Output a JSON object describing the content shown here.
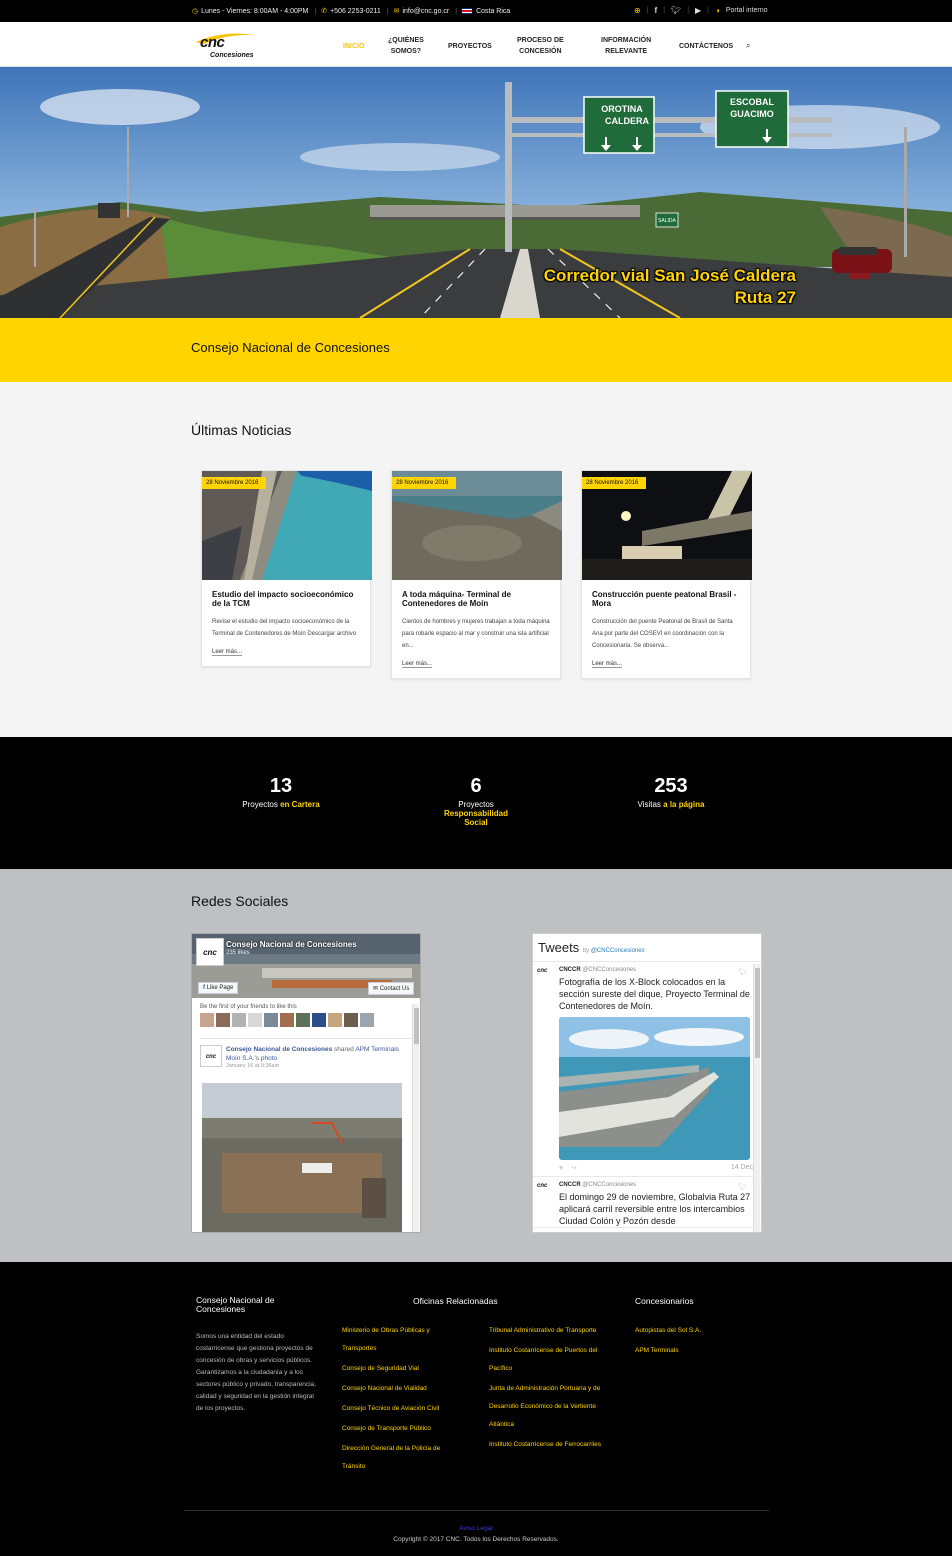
{
  "topbar": {
    "hours": "Lunes - Viernes: 8:00AM - 4:00PM",
    "phone": "+506 2253-0211",
    "email": "info@cnc.go.cr",
    "country": "Costa Rica",
    "portal": "Portal interno",
    "icons": [
      "clock-icon",
      "phone-icon",
      "mail-icon",
      "flag-icon",
      "globe-icon",
      "facebook-icon",
      "twitter-icon",
      "youtube-icon",
      "portal-icon"
    ]
  },
  "nav": {
    "logo_text": "cnc",
    "logo_sub": "Concesiones",
    "items": [
      {
        "line1": "INICIO",
        "line2": ""
      },
      {
        "line1": "¿QUIÉNES",
        "line2": "SOMOS?"
      },
      {
        "line1": "PROYECTOS",
        "line2": ""
      },
      {
        "line1": "PROCESO DE",
        "line2": "CONCESIÓN"
      },
      {
        "line1": "INFORMACIÓN",
        "line2": "RELEVANTE"
      },
      {
        "line1": "CONTÁCTENOS",
        "line2": ""
      }
    ],
    "active_index": 0
  },
  "hero": {
    "caption_line1": "Corredor vial San José Caldera",
    "caption_line2": "Ruta 27",
    "sign1_line1": "OROTINA",
    "sign1_line2": "CALDERA",
    "sign2_line1": "ESCOBAL",
    "sign2_line2": "GUACIMO",
    "sign3": "SALIDA"
  },
  "band": {
    "title": "Consejo Nacional de Concesiones"
  },
  "news": {
    "heading": "Últimas Noticias",
    "read_more": "Leer más...",
    "cards": [
      {
        "date": "28 Noviembre 2016",
        "title": "Estudio del impacto socioeconómico de la TCM",
        "excerpt": "Revise el estudio del impacto socioeconómico de la Terminal de Contenedores de Moín Descargar archivo"
      },
      {
        "date": "28 Noviembre 2016",
        "title": "A toda máquina- Terminal de Contenedores de Moín",
        "excerpt": "Cientos de hombres y mujeres trabajan a toda máquina para robarle espacio al mar y construir una isla artificial en..."
      },
      {
        "date": "28 Noviembre 2016",
        "title": "Construcción puente peatonal Brasil - Mora",
        "excerpt": "Construcción del puente Peatonal de Brasil de Santa Ana por parte del COSEVI en coordinación con la Concesionaria. Se observa..."
      }
    ]
  },
  "counters": [
    {
      "num": "13",
      "label": "Proyectos",
      "highlight": "en Cartera"
    },
    {
      "num": "6",
      "label": "Proyectos",
      "highlight": "Responsabilidad Social"
    },
    {
      "num": "253",
      "label": "Visitas",
      "highlight": "a la página"
    }
  ],
  "social": {
    "heading": "Redes Sociales",
    "facebook": {
      "page_name": "Consejo Nacional de Concesiones",
      "likes": "235 likes",
      "like_btn": "Like Page",
      "contact_btn": "Contact Us",
      "friends_text": "Be the first of your friends to like this",
      "post_author": "Consejo Nacional de Concesiones",
      "post_shared": "shared",
      "post_page": "APM Terminals Moín S.A.",
      "post_suffix": "'s",
      "post_link": "photo",
      "post_time": "January 16 at 9:36am"
    },
    "twitter": {
      "title": "Tweets",
      "by": "by",
      "handle": "@CNCConcesiones",
      "tweets": [
        {
          "name": "CNCCR",
          "handle": "@CNCConcesiones",
          "text": "Fotografía de los X-Block colocados en la sección sureste del dique, Proyecto Terminal de Contenedores de Moín.",
          "date": "14 Dec"
        },
        {
          "name": "CNCCR",
          "handle": "@CNCConcesiones",
          "text": "El domingo 29 de noviembre, Globalvia Ruta 27 aplicará carril reversible entre los intercambios Ciudad Colón y Pozón desde"
        }
      ]
    }
  },
  "footer": {
    "col1_title": "Consejo Nacional de Concesiones",
    "col1_text": "Somos una entidad del estado costarricense que gestiona proyectos de concesión de obras y servicios públicos. Garantizamos a la ciudadanía y a los sectores público y privado, transparencia, calidad y seguridad en la gestión integral de los proyectos.",
    "col2_title": "Oficinas Relacionadas",
    "col2a": [
      "Ministerio de Obras Públicas y Transportes",
      "Consejo de Seguridad Vial",
      "Consejo Nacional de Vialidad",
      "Consejo Técnico de Aviación Civil",
      "Consejo de Transporte Público",
      "Dirección General de la Policía de Tránsito"
    ],
    "col2b": [
      "Tribunal Administrativo de Transporte",
      "Instituto Costarricense de Puertos del Pacífico",
      "Junta de Administración Portuaria y de Desarrollo Económico de la Vertiente Atlántica",
      "Instituto Costarricense de Ferrocarriles"
    ],
    "col3_title": "Concesionarios",
    "col3": [
      "Autopistas del Sol S.A.",
      "APM Terminals"
    ],
    "legal": "Aviso Legal",
    "copyright": "Copyright © 2017 CNC. Todos los Derechos Reservados."
  },
  "colors": {
    "accent": "#ffd400",
    "dark": "#000000",
    "social_bg": "#bfc0c1",
    "news_bg": "#f4f4f4"
  }
}
